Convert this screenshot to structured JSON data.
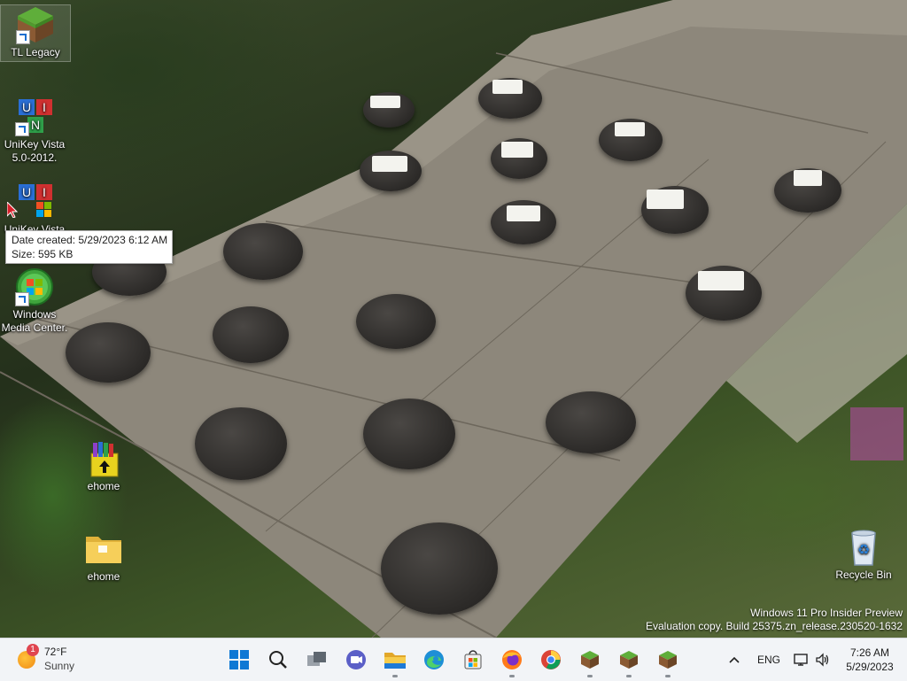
{
  "desktop": {
    "icons": [
      {
        "label": "TL Legacy"
      },
      {
        "label": "UniKey Vista 5.0-2012."
      },
      {
        "label": "UniKey Vista"
      },
      {
        "label": "Windows Media Center."
      },
      {
        "label": "ehome"
      },
      {
        "label": "ehome"
      },
      {
        "label": "Recycle Bin"
      }
    ],
    "tooltip": {
      "date_created": "Date created: 5/29/2023 6:12 AM",
      "size": "Size: 595 KB"
    },
    "watermark": {
      "line1": "Windows 11 Pro Insider Preview",
      "line2": "Evaluation copy. Build 25375.zn_release.230520-1632"
    }
  },
  "taskbar": {
    "weather": {
      "temp": "72°F",
      "condition": "Sunny",
      "badge": "1"
    },
    "apps": [
      "start-icon",
      "search-icon",
      "task-view-icon",
      "meet-icon",
      "file-explorer-icon",
      "edge-icon",
      "store-icon",
      "firefox-icon",
      "chrome-icon",
      "minecraft-icon",
      "minecraft-icon",
      "minecraft-icon"
    ],
    "tray": {
      "language": "ENG",
      "time": "7:26 AM",
      "date": "5/29/2023"
    }
  },
  "colors": {
    "taskbar_bg": "#f2f4f7",
    "accent": "#0067c0"
  }
}
